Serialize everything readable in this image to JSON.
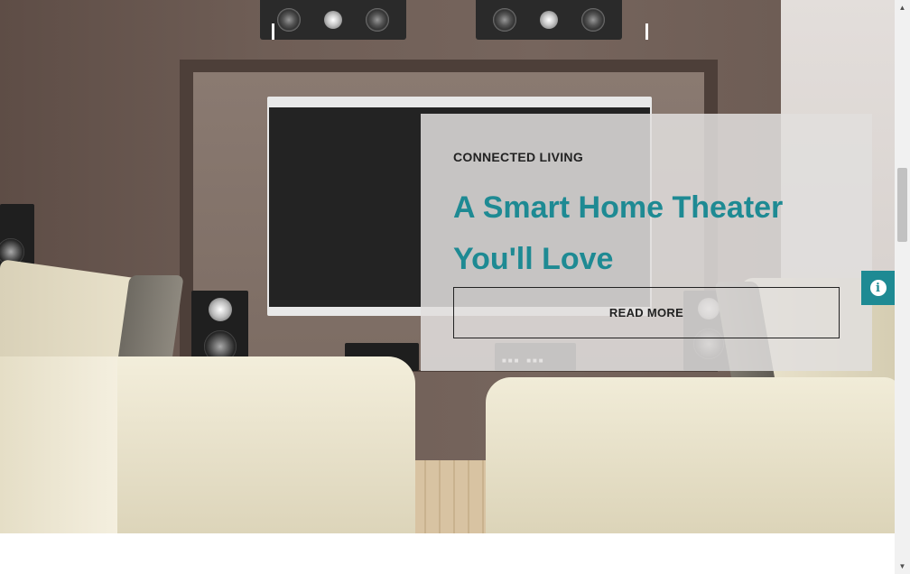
{
  "hero": {
    "image": "smart-home-theater-room",
    "eyebrow": "CONNECTED LIVING",
    "headline": "A Smart Home Theater You'll Love",
    "cta_label": "READ MORE"
  },
  "info_tab": {
    "icon": "info-icon",
    "color": "#1e8a93"
  },
  "colors": {
    "accent": "#1e8a93",
    "card_bg": "#e1dedd",
    "text_dark": "#222222"
  },
  "scrollbar": {
    "up_glyph": "▲",
    "down_glyph": "▼"
  }
}
